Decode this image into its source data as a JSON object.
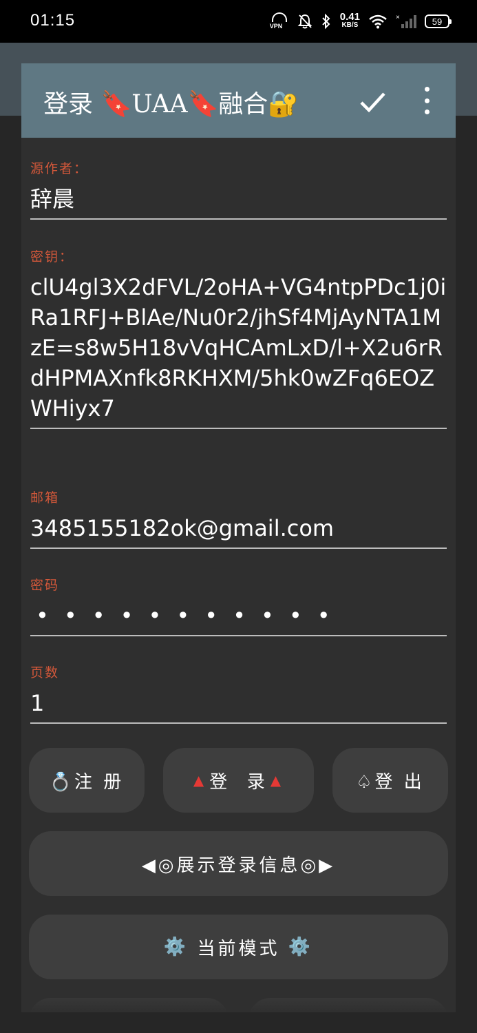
{
  "status_bar": {
    "time": "01:15",
    "vpn_label": "VPN",
    "net_speed_value": "0.41",
    "net_speed_unit": "KB/S",
    "battery": "59"
  },
  "dialog": {
    "title": "登录 🔖UAA🔖融合🔐",
    "fields": {
      "author": {
        "label": "源作者：",
        "value": "辞晨"
      },
      "key": {
        "label": "密钥：",
        "value": "clU4gl3X2dFVL/2oHA+VG4ntpPDc1j0iRa1RFJ+BlAe/Nu0r2/jhSf4MjAyNTA1MzE=s8w5H18vVqHCAmLxD/l+X2u6rRdHPMAXnfk8RKHXM/5hk0wZFq6EOZWHiyx7"
      },
      "email": {
        "label": "邮箱",
        "value": "3485155182ok@gmail.com"
      },
      "password": {
        "label": "密码",
        "value": "•••••••••••"
      },
      "pages": {
        "label": "页数",
        "value": "1"
      }
    },
    "buttons": {
      "register": "💍注 册",
      "login_icon_left": "▲",
      "login": "登  录",
      "login_icon_right": "▲",
      "logout": "♤登 出",
      "show_login_info": "◀◎展示登录信息◎▶",
      "mode_icon_left": "⚙️",
      "current_mode": " 当前模式 ",
      "mode_icon_right": "⚙️"
    }
  },
  "colors": {
    "header": "#5f7883",
    "label": "#d4583a",
    "dialog_bg": "#2f2f2f",
    "button_bg": "#3e3e3e"
  }
}
